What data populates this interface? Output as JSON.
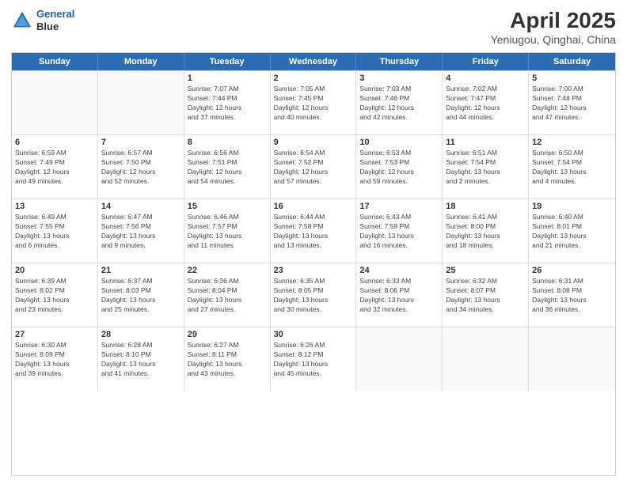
{
  "logo": {
    "line1": "General",
    "line2": "Blue"
  },
  "title": "April 2025",
  "subtitle": "Yeniugou, Qinghai, China",
  "header_days": [
    "Sunday",
    "Monday",
    "Tuesday",
    "Wednesday",
    "Thursday",
    "Friday",
    "Saturday"
  ],
  "weeks": [
    [
      {
        "day": "",
        "info": ""
      },
      {
        "day": "",
        "info": ""
      },
      {
        "day": "1",
        "info": "Sunrise: 7:07 AM\nSunset: 7:44 PM\nDaylight: 12 hours\nand 37 minutes."
      },
      {
        "day": "2",
        "info": "Sunrise: 7:05 AM\nSunset: 7:45 PM\nDaylight: 12 hours\nand 40 minutes."
      },
      {
        "day": "3",
        "info": "Sunrise: 7:03 AM\nSunset: 7:46 PM\nDaylight: 12 hours\nand 42 minutes."
      },
      {
        "day": "4",
        "info": "Sunrise: 7:02 AM\nSunset: 7:47 PM\nDaylight: 12 hours\nand 44 minutes."
      },
      {
        "day": "5",
        "info": "Sunrise: 7:00 AM\nSunset: 7:48 PM\nDaylight: 12 hours\nand 47 minutes."
      }
    ],
    [
      {
        "day": "6",
        "info": "Sunrise: 6:59 AM\nSunset: 7:49 PM\nDaylight: 12 hours\nand 49 minutes."
      },
      {
        "day": "7",
        "info": "Sunrise: 6:57 AM\nSunset: 7:50 PM\nDaylight: 12 hours\nand 52 minutes."
      },
      {
        "day": "8",
        "info": "Sunrise: 6:56 AM\nSunset: 7:51 PM\nDaylight: 12 hours\nand 54 minutes."
      },
      {
        "day": "9",
        "info": "Sunrise: 6:54 AM\nSunset: 7:52 PM\nDaylight: 12 hours\nand 57 minutes."
      },
      {
        "day": "10",
        "info": "Sunrise: 6:53 AM\nSunset: 7:53 PM\nDaylight: 12 hours\nand 59 minutes."
      },
      {
        "day": "11",
        "info": "Sunrise: 6:51 AM\nSunset: 7:54 PM\nDaylight: 13 hours\nand 2 minutes."
      },
      {
        "day": "12",
        "info": "Sunrise: 6:50 AM\nSunset: 7:54 PM\nDaylight: 13 hours\nand 4 minutes."
      }
    ],
    [
      {
        "day": "13",
        "info": "Sunrise: 6:49 AM\nSunset: 7:55 PM\nDaylight: 13 hours\nand 6 minutes."
      },
      {
        "day": "14",
        "info": "Sunrise: 6:47 AM\nSunset: 7:56 PM\nDaylight: 13 hours\nand 9 minutes."
      },
      {
        "day": "15",
        "info": "Sunrise: 6:46 AM\nSunset: 7:57 PM\nDaylight: 13 hours\nand 11 minutes."
      },
      {
        "day": "16",
        "info": "Sunrise: 6:44 AM\nSunset: 7:58 PM\nDaylight: 13 hours\nand 13 minutes."
      },
      {
        "day": "17",
        "info": "Sunrise: 6:43 AM\nSunset: 7:59 PM\nDaylight: 13 hours\nand 16 minutes."
      },
      {
        "day": "18",
        "info": "Sunrise: 6:41 AM\nSunset: 8:00 PM\nDaylight: 13 hours\nand 18 minutes."
      },
      {
        "day": "19",
        "info": "Sunrise: 6:40 AM\nSunset: 8:01 PM\nDaylight: 13 hours\nand 21 minutes."
      }
    ],
    [
      {
        "day": "20",
        "info": "Sunrise: 6:39 AM\nSunset: 8:02 PM\nDaylight: 13 hours\nand 23 minutes."
      },
      {
        "day": "21",
        "info": "Sunrise: 6:37 AM\nSunset: 8:03 PM\nDaylight: 13 hours\nand 25 minutes."
      },
      {
        "day": "22",
        "info": "Sunrise: 6:36 AM\nSunset: 8:04 PM\nDaylight: 13 hours\nand 27 minutes."
      },
      {
        "day": "23",
        "info": "Sunrise: 6:35 AM\nSunset: 8:05 PM\nDaylight: 13 hours\nand 30 minutes."
      },
      {
        "day": "24",
        "info": "Sunrise: 6:33 AM\nSunset: 8:06 PM\nDaylight: 13 hours\nand 32 minutes."
      },
      {
        "day": "25",
        "info": "Sunrise: 6:32 AM\nSunset: 8:07 PM\nDaylight: 13 hours\nand 34 minutes."
      },
      {
        "day": "26",
        "info": "Sunrise: 6:31 AM\nSunset: 8:08 PM\nDaylight: 13 hours\nand 36 minutes."
      }
    ],
    [
      {
        "day": "27",
        "info": "Sunrise: 6:30 AM\nSunset: 8:09 PM\nDaylight: 13 hours\nand 39 minutes."
      },
      {
        "day": "28",
        "info": "Sunrise: 6:28 AM\nSunset: 8:10 PM\nDaylight: 13 hours\nand 41 minutes."
      },
      {
        "day": "29",
        "info": "Sunrise: 6:27 AM\nSunset: 8:11 PM\nDaylight: 13 hours\nand 43 minutes."
      },
      {
        "day": "30",
        "info": "Sunrise: 6:26 AM\nSunset: 8:12 PM\nDaylight: 13 hours\nand 45 minutes."
      },
      {
        "day": "",
        "info": ""
      },
      {
        "day": "",
        "info": ""
      },
      {
        "day": "",
        "info": ""
      }
    ]
  ]
}
